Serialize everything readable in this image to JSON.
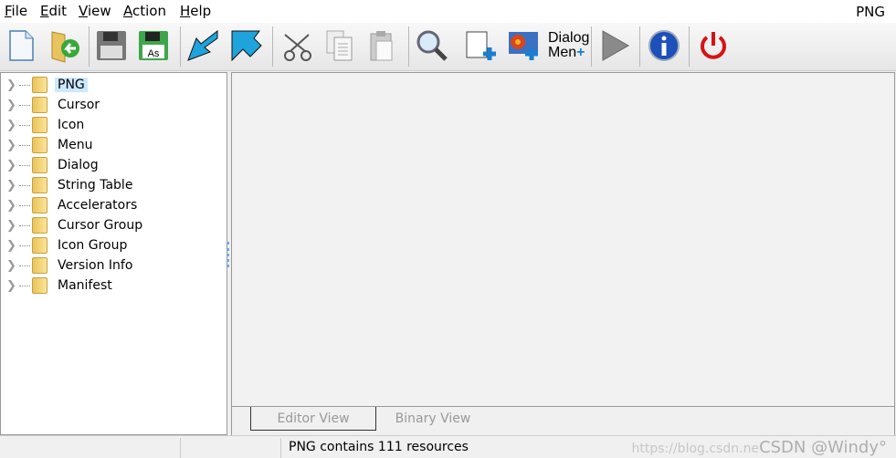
{
  "menu": {
    "items": [
      {
        "label": "File",
        "u": "F",
        "rest": "ile"
      },
      {
        "label": "Edit",
        "u": "E",
        "rest": "dit"
      },
      {
        "label": "View",
        "u": "V",
        "rest": "iew"
      },
      {
        "label": "Action",
        "u": "A",
        "rest": "ction"
      },
      {
        "label": "Help",
        "u": "H",
        "rest": "elp"
      }
    ],
    "title": "PNG"
  },
  "toolbar": {
    "buttons": [
      "new-file-icon",
      "open-file-icon",
      "save-icon",
      "save-as-icon",
      "import-icon",
      "export-icon",
      "cut-icon",
      "copy-icon",
      "paste-icon",
      "search-icon",
      "add-blank-resource-icon",
      "add-image-resource-icon",
      "add-dialog-menu-icon",
      "run-script-icon",
      "info-icon",
      "exit-icon"
    ],
    "save_as_text": "As",
    "dialog_text": "Dialog",
    "menu_text": "Men"
  },
  "tree": {
    "items": [
      "PNG",
      "Cursor",
      "Icon",
      "Menu",
      "Dialog",
      "String Table",
      "Accelerators",
      "Cursor Group",
      "Icon Group",
      "Version Info",
      "Manifest"
    ],
    "selected": "PNG"
  },
  "tabs": {
    "editor": "Editor View",
    "binary": "Binary View"
  },
  "status": {
    "text": "PNG contains 111 resources",
    "watermark_url": "https://blog.csdn.ne",
    "watermark": "CSDN @Windy°"
  },
  "colors": {
    "selection": "#cce8ff",
    "folder": "#f2d273",
    "accent_blue": "#1fa3dc"
  }
}
